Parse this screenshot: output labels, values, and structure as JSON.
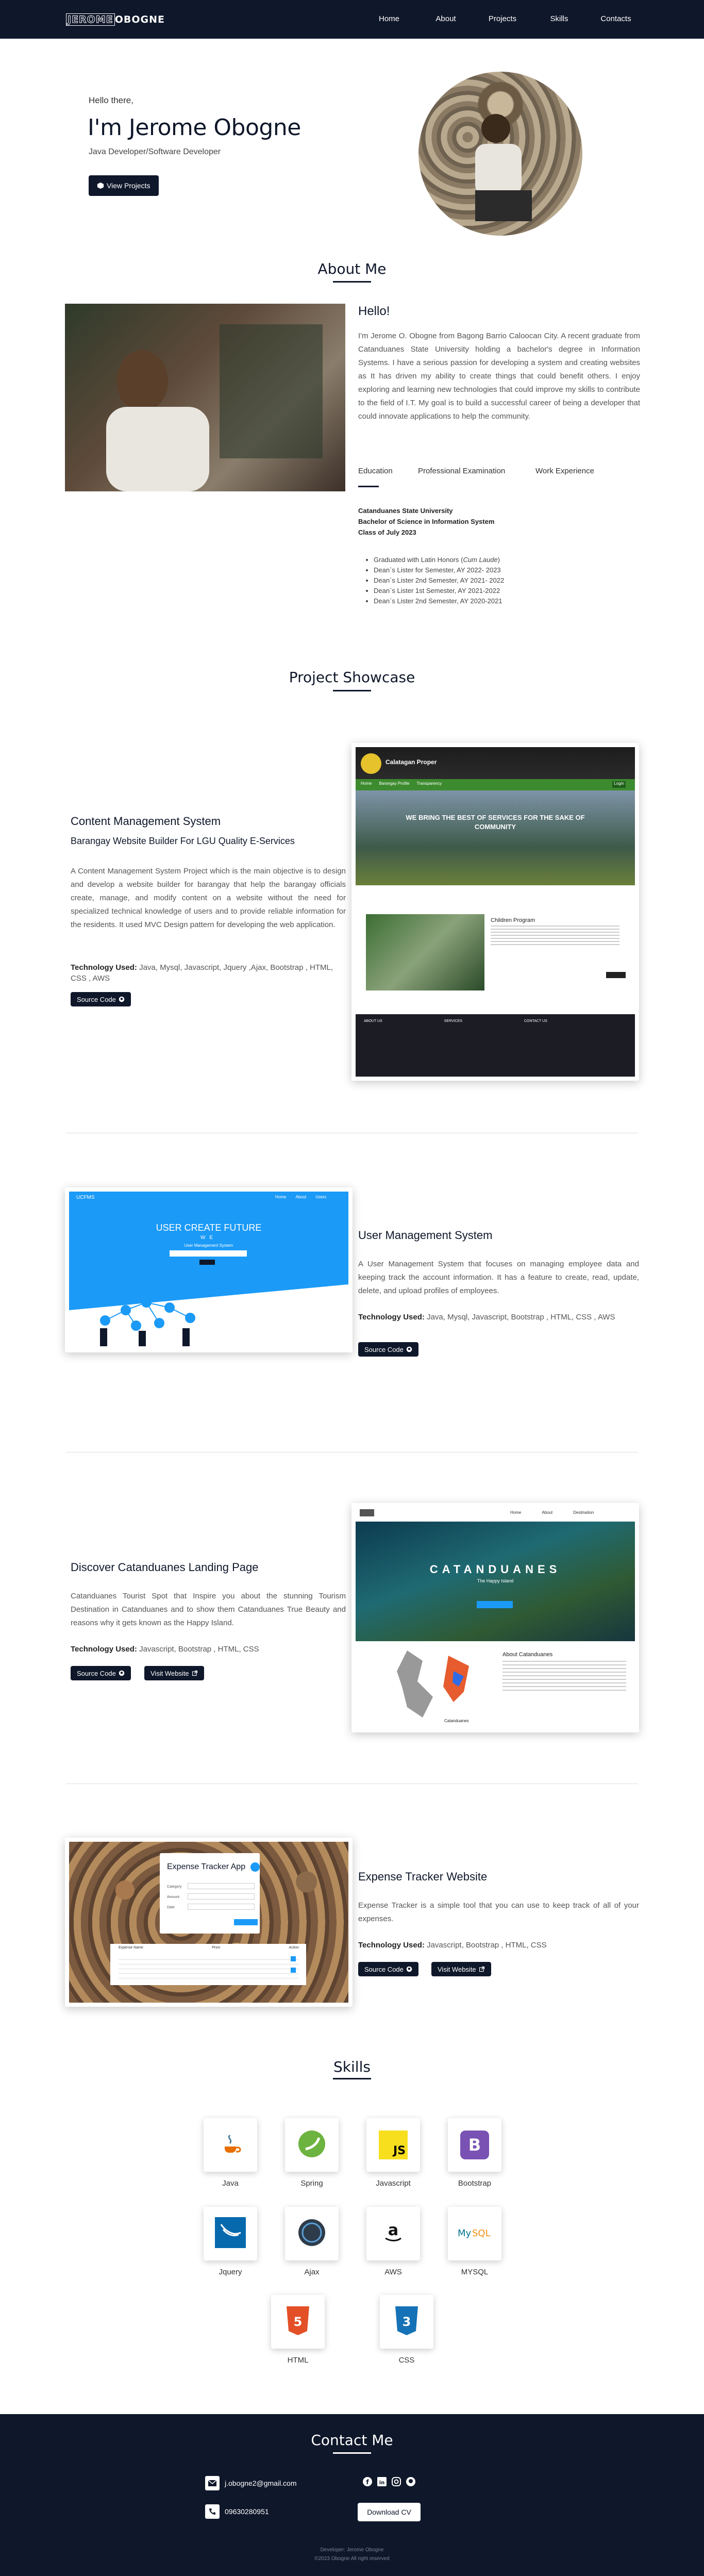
{
  "nav": {
    "logo_a": "JEROME",
    "logo_b": "OBOGNE",
    "links": [
      "Home",
      "About",
      "Projects",
      "Skills",
      "Contacts"
    ]
  },
  "hero": {
    "greeting": "Hello there,",
    "name": "I'm Jerome Obogne",
    "role": "Java Developer/Software Developer",
    "cta": "View Projects"
  },
  "about": {
    "title": "About Me",
    "hello": "Hello!",
    "bio": "I'm Jerome O. Obogne from Bagong Barrio Caloocan City. A recent graduate from Catanduanes State University holding a bachelor's degree in Information Systems. I have a serious passion for developing a system and creating websites as It has driven my ability to create things that could benefit others. I enjoy exploring and learning new technologies that could improve my skills to contribute to the field of I.T. My goal is to build a successful career of being a developer that could innovate applications to help the community.",
    "tabs": [
      "Education",
      "Professional Examination",
      "Work Experience"
    ],
    "school": "Catanduanes State University",
    "degree": "Bachelor of Science in Information System",
    "class": "Class of July 2023",
    "honors_prefix": "Graduated with Latin Honors (",
    "honors_em": "Cum Laude",
    "honors_suffix": ")",
    "listers": [
      "Dean`s Lister for Semester, AY 2022- 2023",
      "Dean`s Lister 2nd Semester, AY 2021- 2022",
      "Dean`s Lister 1st Semester, AY 2021-2022",
      "Dean`s Lister 2nd Semester, AY 2020-2021"
    ]
  },
  "projects": {
    "title": "Project Showcase",
    "items": [
      {
        "title": "Content Management System",
        "subtitle": "Barangay Website Builder For LGU Quality E-Services",
        "desc": "A Content Management System Project which is the main objective is to design and develop a website builder for barangay that help the barangay officials create, manage, and modify content on a website without the need for specialized technical knowledge of users and to provide reliable information for the residents. It used MVC Design pattern for developing the web application.",
        "tech_label": "Technology Used:",
        "tech": " Java, Mysql, Javascript, Jquery ,Ajax, Bootstrap , HTML, CSS , AWS",
        "btn1": "Source Code"
      },
      {
        "title": "User Management System",
        "desc": "A User Management System that focuses on managing employee data and keeping track the account information. It has a feature to create, read, update, delete, and upload profiles of employees.",
        "tech_label": "Technology Used:",
        "tech": " Java, Mysql, Javascript, Bootstrap , HTML, CSS , AWS",
        "btn1": "Source Code"
      },
      {
        "title": "Discover Catanduanes Landing Page",
        "desc": "Catanduanes Tourist Spot that Inspire you about the stunning Tourism Destination in Catanduanes and to show them Catanduanes True Beauty and reasons why it gets known as the Happy Island.",
        "tech_label": "Technology Used:",
        "tech": " Javascript, Bootstrap , HTML, CSS",
        "btn1": "Source Code",
        "btn2": "Visit Website"
      },
      {
        "title": "Expense Tracker Website",
        "desc": "Expense Tracker is a simple tool that you can use to keep track of all of your expenses.",
        "tech_label": "Technology Used:",
        "tech": " Javascript, Bootstrap , HTML, CSS",
        "btn1": "Source Code",
        "btn2": "Visit Website"
      }
    ],
    "shots": {
      "cms_brand": "Calatagan Proper",
      "cms_nav": [
        "Home",
        "Barangay Profile",
        "Transparency"
      ],
      "cms_login": "Login",
      "cms_hero": "WE BRING THE BEST OF SERVICES FOR THE SAKE OF COMMUNITY",
      "cms_news_title": "Children Program",
      "cms_footer_cols": [
        "ABOUT US",
        "SERVICES",
        "CONTACT US"
      ],
      "ums_brand": "UCFMS",
      "ums_nav": [
        "Home",
        "About",
        "Users"
      ],
      "ums_hero": "USER CREATE FUTURE",
      "ums_hero_sub": "WE",
      "ums_hero_small": "User Management System",
      "cat_hero": "CATANDUANES",
      "cat_sub": "The Happy Island",
      "cat_about": "About Catanduanes",
      "cat_label": "Catanduanes",
      "cat_nav": [
        "Home",
        "About",
        "Destination"
      ],
      "exp_title": "Expense Tracker App",
      "exp_fields": [
        "Category",
        "Amount",
        "Date"
      ],
      "exp_cols": [
        "Expense Name",
        "Price",
        "Action"
      ]
    }
  },
  "skills": {
    "title": "Skills",
    "items": [
      "Java",
      "Spring",
      "Javascript",
      "Bootstrap",
      "Jquery",
      "Ajax",
      "AWS",
      "MYSQL",
      "HTML",
      "CSS"
    ]
  },
  "contact": {
    "title": "Contact Me",
    "email": "j.obogne2@gmail.com",
    "phone": "09630280951",
    "download": "Download CV",
    "credit": "Developer: Jerome Obogne",
    "copyright": "©2023 Obogne All right reserved"
  },
  "colors": {
    "navy": "#0f172a",
    "blue": "#1b9af7",
    "green": "#3d8b2f"
  }
}
